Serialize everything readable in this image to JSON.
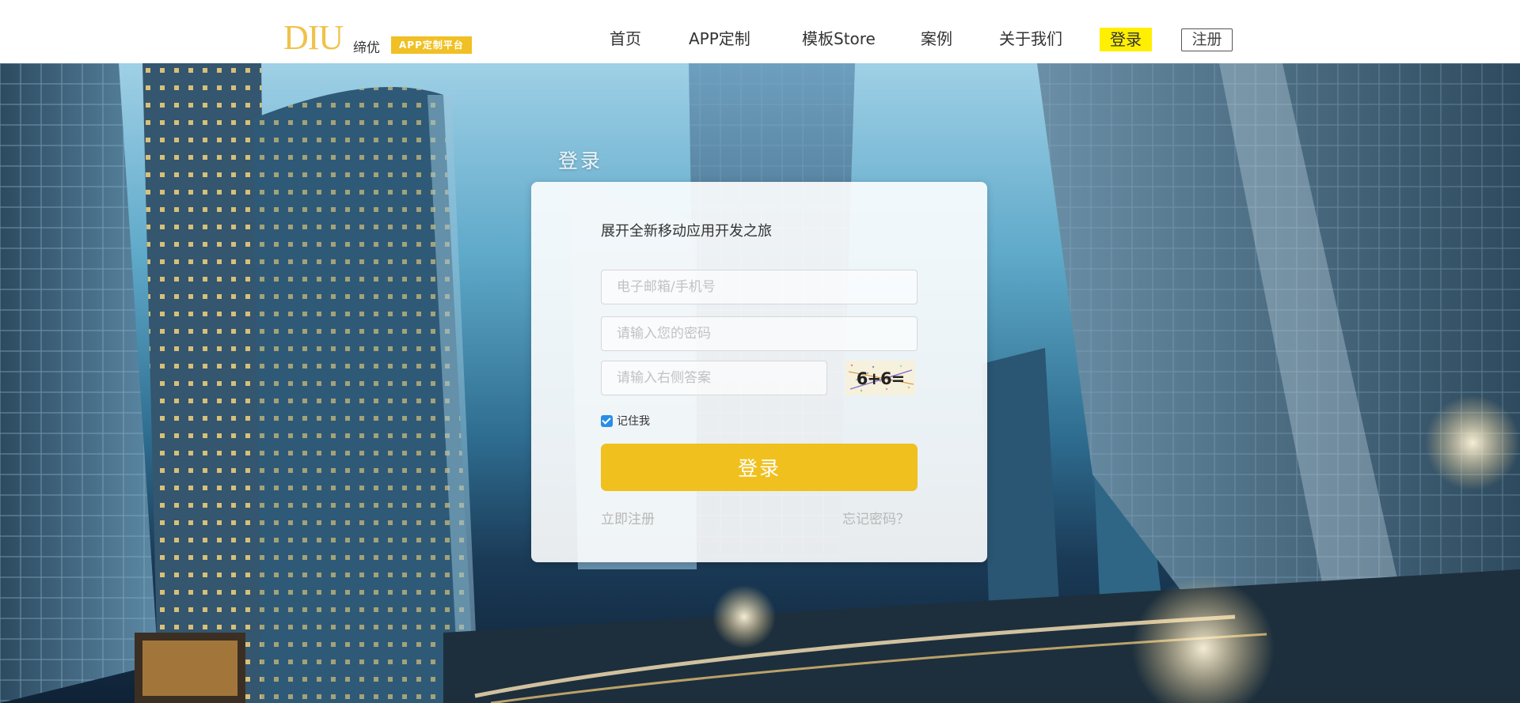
{
  "brand": {
    "logo_mark": "DIU",
    "logo_name": "缔优",
    "badge": "APP定制平台"
  },
  "nav": {
    "items": [
      {
        "label": "首页"
      },
      {
        "label": "APP定制"
      },
      {
        "label": "模板Store"
      },
      {
        "label": "案例"
      },
      {
        "label": "关于我们"
      }
    ],
    "login": "登录",
    "register": "注册"
  },
  "login_form": {
    "title": "登录",
    "tagline": "展开全新移动应用开发之旅",
    "account_placeholder": "电子邮箱/手机号",
    "password_placeholder": "请输入您的密码",
    "captcha_placeholder": "请输入右侧答案",
    "captcha_text": "6+6=",
    "remember_label": "记住我",
    "remember_checked": true,
    "submit_label": "登录",
    "register_link": "立即注册",
    "forgot_link": "忘记密码？"
  },
  "colors": {
    "accent": "#f0c01f",
    "nav_highlight": "#ffef00",
    "checkbox": "#2a8ee5"
  }
}
